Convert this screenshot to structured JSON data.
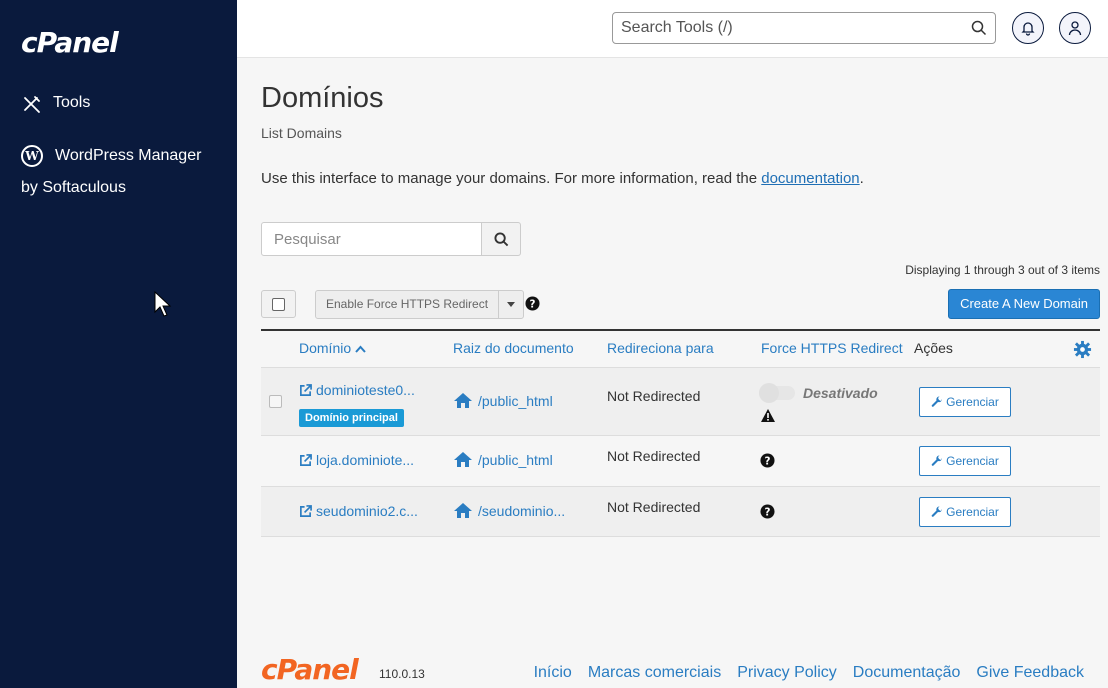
{
  "sidebar": {
    "logo": "cPanel",
    "items": [
      {
        "label": "Tools",
        "icon": "tools-icon"
      },
      {
        "label": "WordPress Manager by Softaculous",
        "icon": "wordpress-icon"
      }
    ]
  },
  "header": {
    "search_placeholder": "Search Tools (/)"
  },
  "page": {
    "title": "Domínios",
    "subtitle": "List Domains",
    "description": "Use this interface to manage your domains. For more information, read the ",
    "doc_link": "documentation",
    "desc_end": "."
  },
  "toolbar": {
    "search_placeholder": "Pesquisar",
    "displaying": "Displaying 1 through 3 out of 3 items",
    "https_button": "Enable Force HTTPS Redirect",
    "create_button": "Create A New Domain"
  },
  "table": {
    "columns": [
      "Domínio",
      "Raiz do documento",
      "Redireciona para",
      "Force HTTPS Redirect",
      "Ações"
    ],
    "rows": [
      {
        "domain": "dominioteste0...",
        "badge": "Domínio principal",
        "docroot": "/public_html",
        "redirect": "Not Redirected",
        "https": "Desativado",
        "action": "Gerenciar"
      },
      {
        "domain": "loja.dominiote...",
        "docroot": "/public_html",
        "redirect": "Not Redirected",
        "action": "Gerenciar"
      },
      {
        "domain": "seudominio2.c...",
        "docroot": "/seudominio...",
        "redirect": "Not Redirected",
        "action": "Gerenciar"
      }
    ]
  },
  "footer": {
    "logo": "cPanel",
    "version": "110.0.13",
    "links": [
      "Início",
      "Marcas comerciais",
      "Privacy Policy",
      "Documentação",
      "Give Feedback"
    ]
  },
  "colors": {
    "sidebar_bg": "#0a1a3d",
    "link": "#2a7dc2",
    "primary_button": "#2a86d4",
    "badge": "#1a9ad6",
    "brand_orange": "#f26522"
  }
}
